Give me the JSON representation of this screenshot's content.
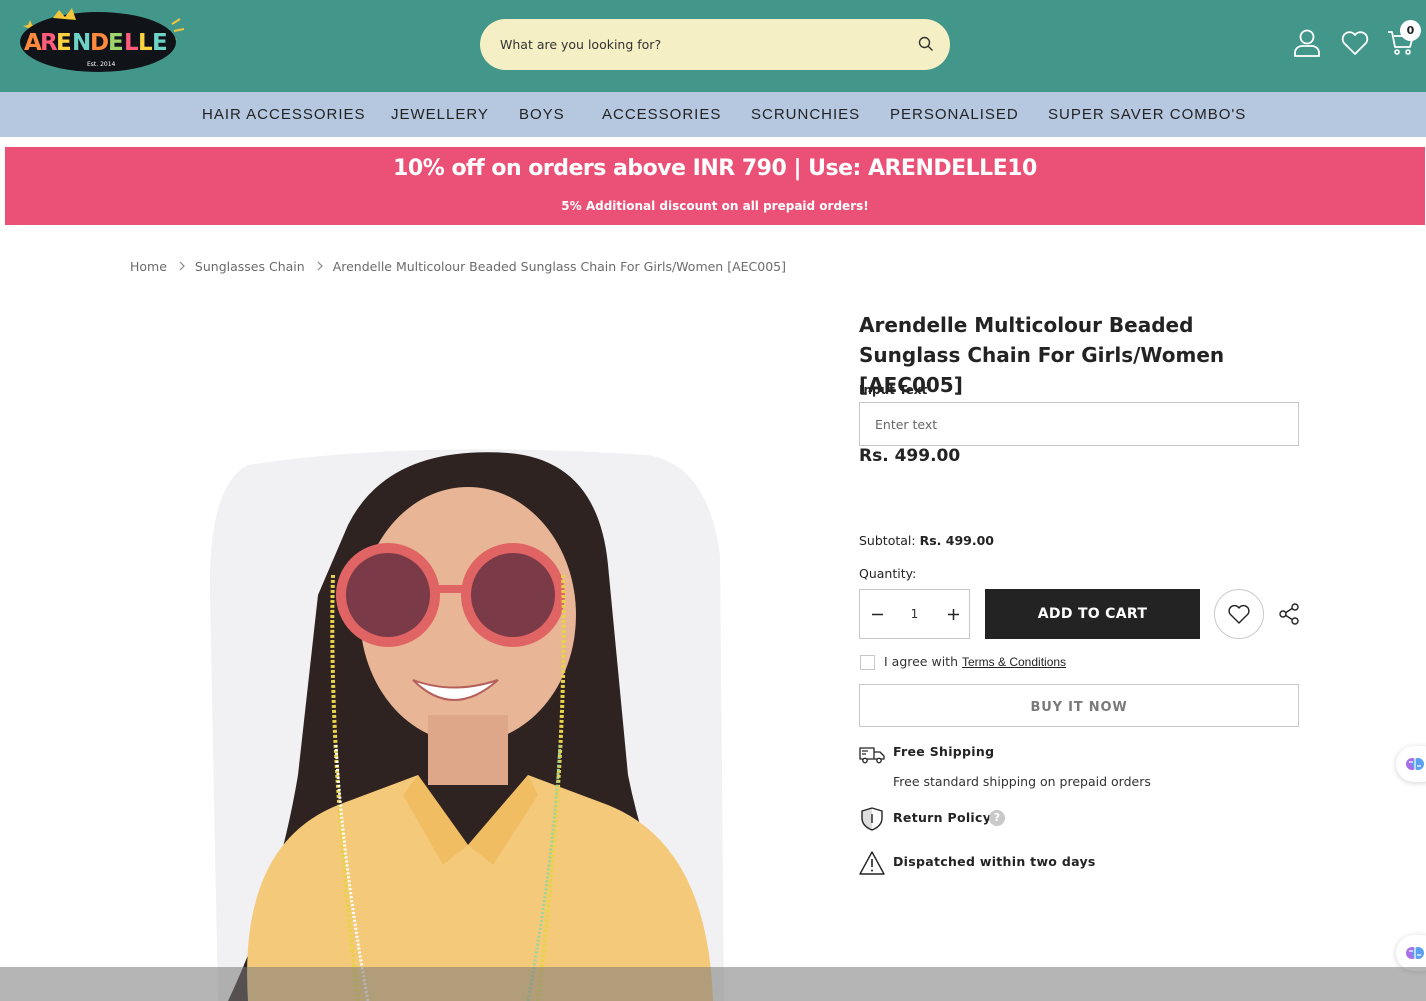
{
  "header": {
    "logo_text": "ARENDELLE",
    "logo_tagline": "Est. 2014",
    "search_placeholder": "What are you looking for?",
    "cart_count": "0"
  },
  "nav": {
    "items": [
      {
        "label": "HAIR ACCESSORIES"
      },
      {
        "label": "JEWELLERY"
      },
      {
        "label": "BOYS"
      },
      {
        "label": "ACCESSORIES"
      },
      {
        "label": "SCRUNCHIES"
      },
      {
        "label": "PERSONALISED"
      },
      {
        "label": "SUPER SAVER COMBO'S"
      }
    ]
  },
  "promo": {
    "title": "10% off on orders above INR 790 | Use: ARENDELLE10",
    "subtitle": "5% Additional discount on all prepaid orders!"
  },
  "breadcrumb": {
    "items": [
      "Home",
      "Sunglasses Chain",
      "Arendelle Multicolour Beaded Sunglass Chain For Girls/Women [AEC005]"
    ]
  },
  "product": {
    "title": "Arendelle Multicolour Beaded Sunglass Chain For Girls/Women [AEC005]",
    "input_label": "Input Text",
    "input_placeholder": "Enter text",
    "price": "Rs. 499.00",
    "subtotal_label": "Subtotal:",
    "subtotal_value": "Rs. 499.00",
    "quantity_label": "Quantity:",
    "quantity_value": "1",
    "add_to_cart": "ADD TO CART",
    "agree_text": "I agree with",
    "terms_link": "Terms & Conditions",
    "buy_now": "BUY IT NOW"
  },
  "info": {
    "shipping_title": "Free Shipping",
    "shipping_sub": "Free standard shipping on prepaid orders",
    "return_title": "Return Policy",
    "dispatch_title": "Dispatched within two days"
  },
  "colors": {
    "header_bg": "#42978a",
    "search_bg": "#f4efc4",
    "nav_bg": "#b6c7e0",
    "promo_bg": "#eb5176",
    "button_dark": "#232323"
  },
  "icons": [
    "crown-icon",
    "search-icon",
    "user-icon",
    "heart-icon",
    "cart-icon",
    "chevron-right-icon",
    "minus-icon",
    "plus-icon",
    "share-icon",
    "truck-icon",
    "shield-icon",
    "help-icon",
    "warning-icon",
    "brain-icon"
  ]
}
